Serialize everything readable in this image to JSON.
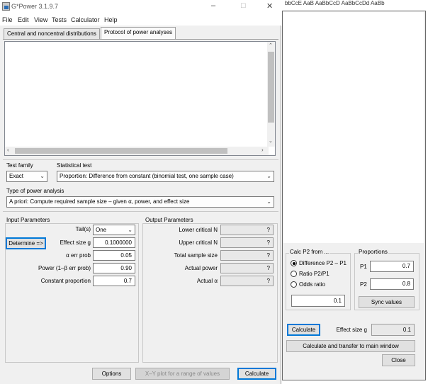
{
  "window": {
    "title": "G*Power 3.1.9.7",
    "controls": [
      "–",
      "□",
      "✕"
    ]
  },
  "menu": [
    "File",
    "Edit",
    "View",
    "Tests",
    "Calculator",
    "Help"
  ],
  "tabs": [
    "Central and noncentral distributions",
    "Protocol of power analyses"
  ],
  "test_family": {
    "label": "Test family",
    "value": "Exact"
  },
  "statistical_test": {
    "label": "Statistical test",
    "value": "Proportion: Difference from constant (binomial test, one sample case)"
  },
  "power_analysis": {
    "label": "Type of power analysis",
    "value": "A priori: Compute required sample size – given α, power, and effect size"
  },
  "input": {
    "title": "Input Parameters",
    "determine": "Determine =>",
    "tails_label": "Tail(s)",
    "tails_value": "One",
    "rows": [
      {
        "label": "Effect size g",
        "value": "0.1000000"
      },
      {
        "label": "α err prob",
        "value": "0.05"
      },
      {
        "label": "Power (1–β err prob)",
        "value": "0.90"
      },
      {
        "label": "Constant proportion",
        "value": "0.7"
      }
    ]
  },
  "output": {
    "title": "Output Parameters",
    "rows": [
      {
        "label": "Lower critical N",
        "value": "?"
      },
      {
        "label": "Upper critical N",
        "value": "?"
      },
      {
        "label": "Total sample size",
        "value": "?"
      },
      {
        "label": "Actual power",
        "value": "?"
      },
      {
        "label": "Actual α",
        "value": "?"
      }
    ]
  },
  "bottom_buttons": {
    "options": "Options",
    "xy": "X–Y plot for a range of values",
    "calculate": "Calculate"
  },
  "side": {
    "calc_group": "Calc P2 from ...",
    "radios": [
      "Difference P2 – P1",
      "Ratio P2/P1",
      "Odds ratio"
    ],
    "calc_value": "0.1",
    "proportions_group": "Proportions",
    "p1_label": "P1",
    "p1_value": "0.7",
    "p2_label": "P2",
    "p2_value": "0.8",
    "sync": "Sync values",
    "calculate": "Calculate",
    "effect_label": "Effect size g",
    "effect_value": "0.1",
    "transfer": "Calculate and transfer to main window",
    "close": "Close"
  },
  "background_text": "bbCcE   AaB   AaBbCcD   AaBbCcDd   AaBb"
}
